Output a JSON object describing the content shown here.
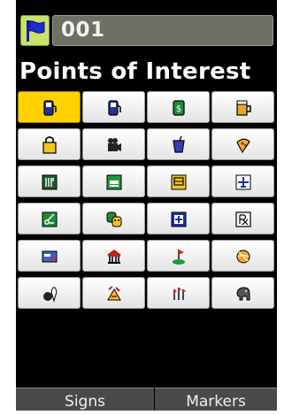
{
  "header": {
    "flag_icon": "blue-flag-icon",
    "name_value": "001"
  },
  "title": "Points of Interest",
  "categories": [
    {
      "icon": "fuel-pump-icon",
      "selected": true
    },
    {
      "icon": "fuel-station-icon"
    },
    {
      "icon": "money-bank-icon"
    },
    {
      "icon": "beer-mug-icon"
    },
    {
      "icon": "shopping-bag-icon"
    },
    {
      "icon": "movie-camera-icon"
    },
    {
      "icon": "drink-cup-icon"
    },
    {
      "icon": "pizza-icon"
    },
    {
      "icon": "restaurant-icon"
    },
    {
      "icon": "lodging-bed-icon"
    },
    {
      "icon": "building-icon"
    },
    {
      "icon": "airport-icon"
    },
    {
      "icon": "scissors-icon"
    },
    {
      "icon": "theater-masks-icon"
    },
    {
      "icon": "hospital-icon"
    },
    {
      "icon": "pharmacy-icon"
    },
    {
      "icon": "credit-card-icon"
    },
    {
      "icon": "museum-icon"
    },
    {
      "icon": "golf-icon"
    },
    {
      "icon": "sports-ball-icon"
    },
    {
      "icon": "bowling-icon"
    },
    {
      "icon": "amusement-park-icon"
    },
    {
      "icon": "hiking-icon"
    },
    {
      "icon": "zoo-elephant-icon"
    }
  ],
  "softkeys": {
    "left": "Signs",
    "right": "Markers"
  },
  "colors": {
    "selected": "#ffd200",
    "background": "#000000",
    "header_field": "#6d7163",
    "flag_button": "#c8e26a"
  }
}
